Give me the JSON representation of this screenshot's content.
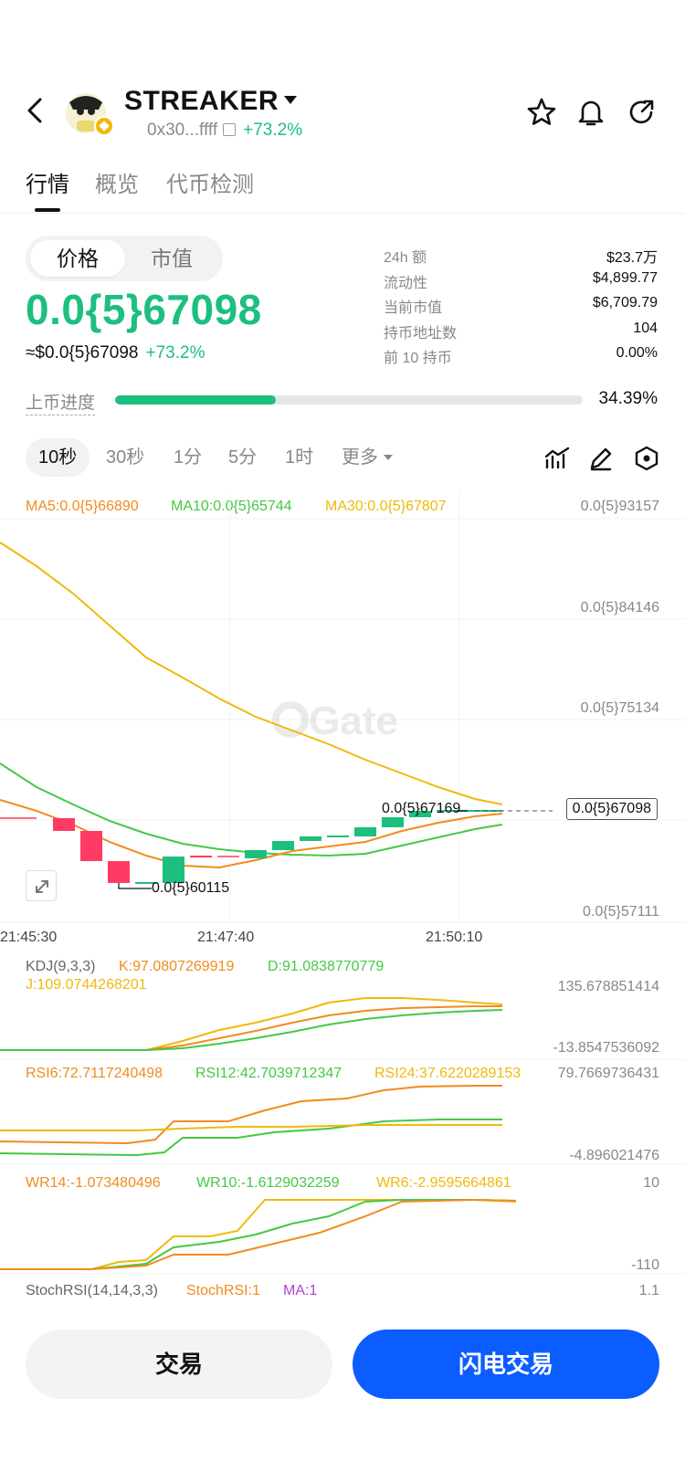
{
  "header": {
    "title": "STREAKER",
    "address": "0x30...ffff",
    "change": "+73.2%",
    "icons": [
      "back-icon",
      "star-icon",
      "bell-icon",
      "share-icon"
    ]
  },
  "tabs": [
    "行情",
    "概览",
    "代币检测"
  ],
  "price_toggle": [
    "价格",
    "市值"
  ],
  "price": {
    "main": "0.0{5}67098",
    "usd": "≈$0.0{5}67098",
    "change": "+73.2%"
  },
  "stats": [
    {
      "label": "24h  额",
      "value": "$23.7万"
    },
    {
      "label": "流动性",
      "value": "$4,899.77"
    },
    {
      "label": "当前市值",
      "value": "$6,709.79"
    },
    {
      "label": "持币地址数",
      "value": "104"
    },
    {
      "label": "前 10 持币",
      "value": "0.00%"
    }
  ],
  "progress": {
    "label": "上币进度",
    "value": "34.39%",
    "fraction": 0.3439
  },
  "intervals": [
    "10秒",
    "30秒",
    "1分",
    "5分",
    "1时",
    "更多"
  ],
  "chart_data": {
    "type": "line",
    "ma": {
      "ma5": "MA5:0.0{5}66890",
      "ma10": "MA10:0.0{5}65744",
      "ma30": "MA30:0.0{5}67807"
    },
    "y_ticks": [
      "0.0{5}93157",
      "0.0{5}84146",
      "0.0{5}75134",
      "0.0{5}67098",
      "0.0{5}57111"
    ],
    "x_ticks": [
      "21:45:30",
      "21:47:40",
      "21:50:10"
    ],
    "high_label": "0.0{5}67169",
    "low_label": "0.0{5}60115",
    "current_price": "0.0{5}67098",
    "watermark": "Gate",
    "colors": {
      "up": "#1dbf7f",
      "down": "#ff3b63",
      "ma5": "#f08c21",
      "ma10": "#45c845",
      "ma30": "#f0b90b"
    }
  },
  "indicators": {
    "kdj": {
      "name": "KDJ(9,3,3)",
      "k": "K:97.0807269919",
      "d": "D:91.0838770779",
      "j": "J:109.0744268201",
      "top": "135.678851414",
      "bottom": "-13.8547536092"
    },
    "rsi": {
      "r6": "RSI6:72.7117240498",
      "r12": "RSI12:42.7039712347",
      "r24": "RSI24:37.6220289153",
      "top": "79.7669736431",
      "bottom": "-4.896021476"
    },
    "wr": {
      "w14": "WR14:-1.073480496",
      "w10": "WR10:-1.6129032259",
      "w6": "WR6:-2.9595664861",
      "top": "10",
      "bottom": "-110"
    },
    "stochrsi": {
      "name": "StochRSI(14,14,3,3)",
      "value": "StochRSI:1",
      "ma": "MA:1",
      "top": "1.1"
    }
  },
  "buttons": {
    "trade": "交易",
    "flash": "闪电交易"
  }
}
